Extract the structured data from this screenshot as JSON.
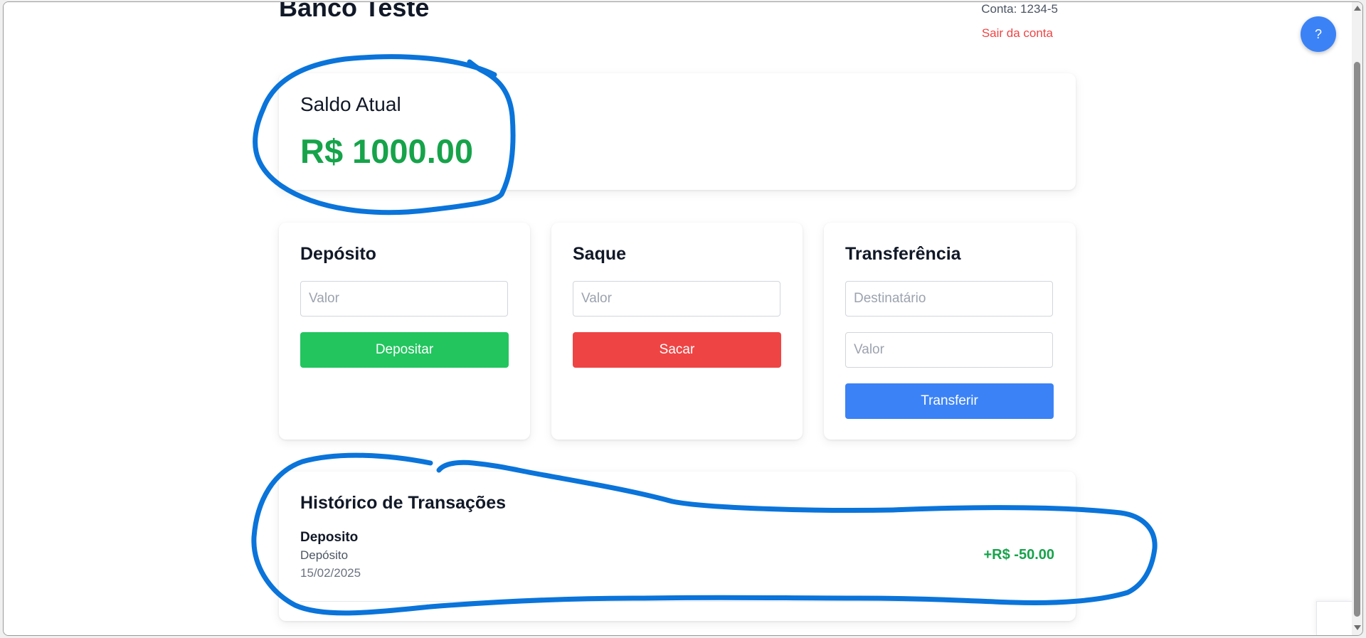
{
  "header": {
    "bank_name": "Banco Teste",
    "account_label": "Conta: 1234-5",
    "logout_label": "Sair da conta"
  },
  "help": {
    "label": "?"
  },
  "balance": {
    "title": "Saldo Atual",
    "value": "R$ 1000.00"
  },
  "deposit": {
    "title": "Depósito",
    "amount_placeholder": "Valor",
    "button_label": "Depositar"
  },
  "withdraw": {
    "title": "Saque",
    "amount_placeholder": "Valor",
    "button_label": "Sacar"
  },
  "transfer": {
    "title": "Transferência",
    "recipient_placeholder": "Destinatário",
    "amount_placeholder": "Valor",
    "button_label": "Transferir"
  },
  "history": {
    "title": "Histórico de Transações",
    "transactions": [
      {
        "name": "Deposito",
        "type": "Depósito",
        "date": "15/02/2025",
        "amount": "+R$ -50.00"
      }
    ]
  },
  "colors": {
    "positive": "#16a34a",
    "deposit_button": "#22c55e",
    "withdraw_button": "#ef4444",
    "transfer_button": "#3b82f6",
    "annotation": "#0a74da"
  }
}
